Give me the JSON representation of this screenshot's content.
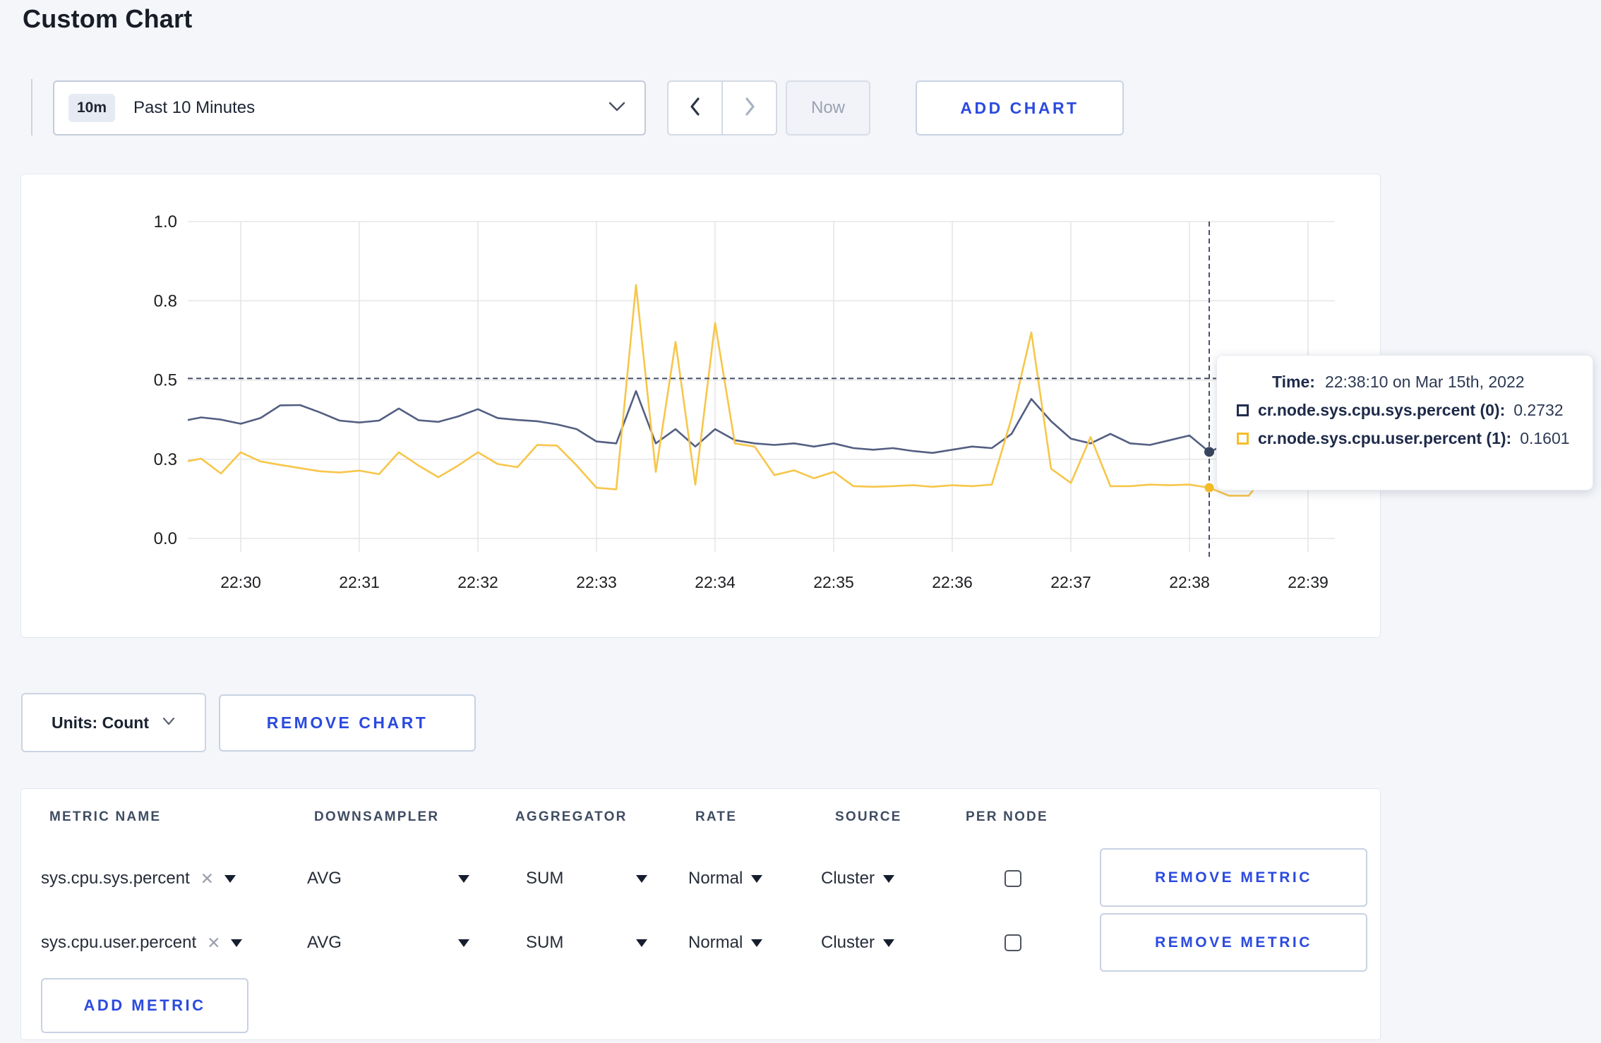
{
  "page": {
    "title": "Custom Chart"
  },
  "toolbar": {
    "time_range": {
      "badge": "10m",
      "label": "Past 10 Minutes"
    },
    "now_label": "Now",
    "add_chart_label": "ADD CHART"
  },
  "chart_data": {
    "type": "line",
    "title": "",
    "x_ticks": [
      "22:30",
      "22:31",
      "22:32",
      "22:33",
      "22:34",
      "22:35",
      "22:36",
      "22:37",
      "22:38",
      "22:39"
    ],
    "y_tick_labels": [
      "0.0",
      "0.3",
      "0.5",
      "0.8",
      "1.0"
    ],
    "y_tick_values": [
      0,
      0.25,
      0.5,
      0.75,
      1.0
    ],
    "ylim": [
      0,
      1
    ],
    "grid": true,
    "start_time": "22:29:30",
    "interval_seconds": 10,
    "series": [
      {
        "name": "cr.node.sys.cpu.sys.percent (0)",
        "color": "#535f82",
        "values": [
          0.37,
          0.382,
          0.375,
          0.362,
          0.38,
          0.42,
          0.421,
          0.398,
          0.372,
          0.366,
          0.372,
          0.41,
          0.373,
          0.368,
          0.385,
          0.408,
          0.38,
          0.374,
          0.37,
          0.36,
          0.345,
          0.306,
          0.3,
          0.465,
          0.3,
          0.345,
          0.29,
          0.345,
          0.31,
          0.3,
          0.295,
          0.3,
          0.29,
          0.3,
          0.285,
          0.28,
          0.285,
          0.276,
          0.27,
          0.28,
          0.29,
          0.285,
          0.33,
          0.44,
          0.37,
          0.315,
          0.3,
          0.33,
          0.3,
          0.295,
          0.31,
          0.325,
          0.2732,
          0.3,
          0.3,
          0.31,
          0.3,
          0.31,
          0.3
        ]
      },
      {
        "name": "cr.node.sys.cpu.user.percent (1)",
        "color": "#f7c64a",
        "values": [
          0.24,
          0.252,
          0.205,
          0.272,
          0.243,
          0.232,
          0.222,
          0.212,
          0.208,
          0.214,
          0.203,
          0.272,
          0.23,
          0.193,
          0.23,
          0.272,
          0.235,
          0.225,
          0.295,
          0.293,
          0.23,
          0.16,
          0.155,
          0.8,
          0.21,
          0.62,
          0.17,
          0.68,
          0.3,
          0.29,
          0.2,
          0.215,
          0.19,
          0.21,
          0.165,
          0.163,
          0.165,
          0.168,
          0.163,
          0.168,
          0.165,
          0.17,
          0.38,
          0.65,
          0.22,
          0.175,
          0.32,
          0.165,
          0.165,
          0.17,
          0.168,
          0.17,
          0.1601,
          0.135,
          0.135,
          0.215,
          0.17,
          0.16,
          0.28
        ]
      }
    ],
    "crosshair": {
      "time": "22:38:10",
      "minutes_after_2230": 8.1667,
      "hline_value": 0.505,
      "point_values": [
        0.2732,
        0.1601
      ]
    }
  },
  "tooltip": {
    "time_label": "Time:",
    "time_value": "22:38:10 on Mar 15th, 2022",
    "entries": [
      {
        "label": "cr.node.sys.cpu.sys.percent (0):",
        "value": "0.2732",
        "color": "#222c4e"
      },
      {
        "label": "cr.node.sys.cpu.user.percent (1):",
        "value": "0.1601",
        "color": "#f5bd27"
      }
    ]
  },
  "chart_controls": {
    "units_label": "Units: Count",
    "remove_chart_label": "REMOVE CHART"
  },
  "metrics_table": {
    "columns": [
      "METRIC NAME",
      "DOWNSAMPLER",
      "AGGREGATOR",
      "RATE",
      "SOURCE",
      "PER NODE"
    ],
    "rows": [
      {
        "metric_name": "sys.cpu.sys.percent",
        "downsampler": "AVG",
        "aggregator": "SUM",
        "rate": "Normal",
        "source": "Cluster",
        "per_node_checked": false
      },
      {
        "metric_name": "sys.cpu.user.percent",
        "downsampler": "AVG",
        "aggregator": "SUM",
        "rate": "Normal",
        "source": "Cluster",
        "per_node_checked": false
      }
    ],
    "remove_metric_label": "REMOVE METRIC",
    "add_metric_label": "ADD METRIC"
  },
  "colors": {
    "accent_blue": "#2b4adf",
    "series_sys": "#535f82",
    "series_user": "#f7c64a",
    "crosshair": "#47536b",
    "gridline": "#e6e6e6",
    "page_bg": "#f4f6fa"
  }
}
